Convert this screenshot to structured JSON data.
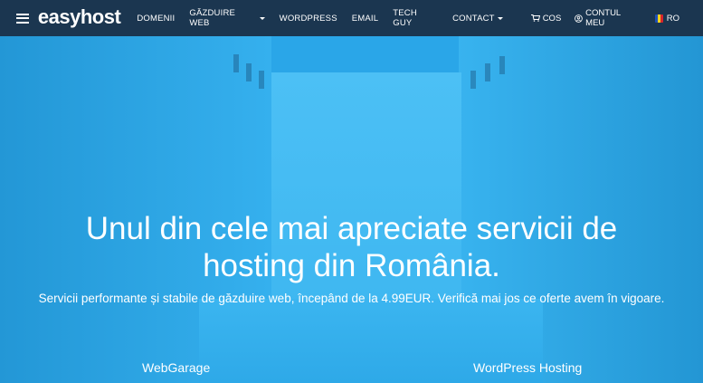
{
  "brand": {
    "logo": "easyhost"
  },
  "nav": {
    "items": [
      {
        "label": "DOMENII",
        "dropdown": false
      },
      {
        "label": "GĂZDUIRE WEB",
        "dropdown": true
      },
      {
        "label": "WORDPRESS",
        "dropdown": false
      },
      {
        "label": "EMAIL",
        "dropdown": false
      },
      {
        "label": "TECH GUY",
        "dropdown": false
      },
      {
        "label": "CONTACT",
        "dropdown": true
      }
    ],
    "cart_label": "COS",
    "account_label": "CONTUL MEU",
    "language_label": "RO"
  },
  "hero": {
    "headline_line1": "Unul din cele mai apreciate servicii de",
    "headline_line2": "hosting din România.",
    "subtitle": "Servicii performante și stabile de găzduire web, începând de la 4.99EUR. Verifică mai jos ce oferte avem în vigoare."
  },
  "plans": [
    {
      "name": "WebGarage"
    },
    {
      "name": "WordPress Hosting"
    }
  ],
  "colors": {
    "navbar": "#1b3650",
    "hero_overlay": "#2aa6e8"
  },
  "icons": {
    "menu": "hamburger-icon",
    "cart": "cart-icon",
    "account": "user-icon",
    "language": "romania-flag-icon"
  }
}
